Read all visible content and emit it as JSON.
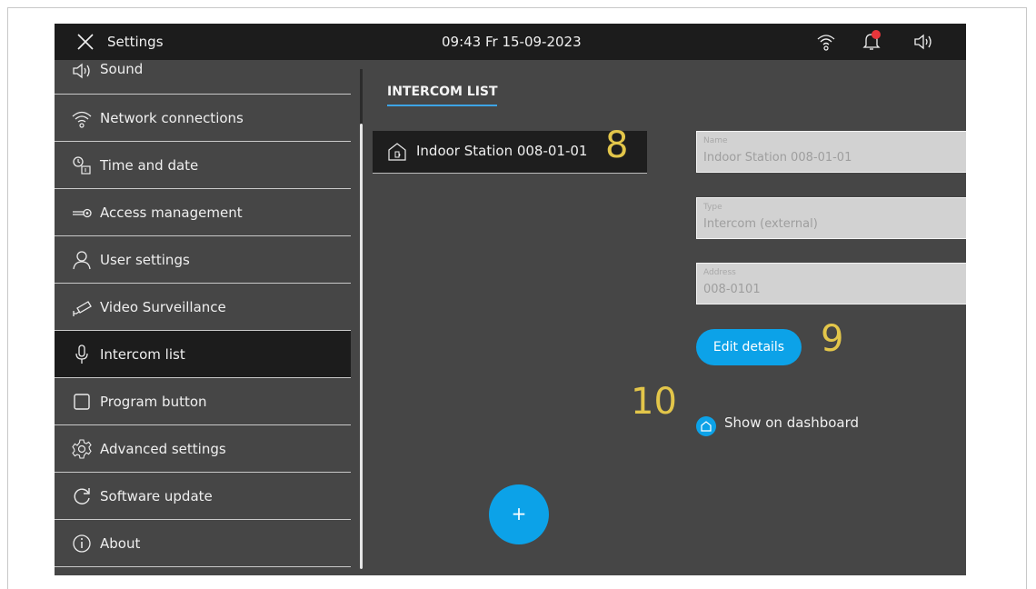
{
  "topbar": {
    "title": "Settings",
    "datetime": "09:43  Fr 15-09-2023",
    "icons": [
      "close-icon",
      "wifi-icon",
      "notification-bell-icon",
      "speaker-icon"
    ],
    "notification_dot_color": "#e8363b"
  },
  "sidebar": {
    "items": [
      {
        "label": "Sound",
        "icon": "speaker-icon"
      },
      {
        "label": "Network connections",
        "icon": "wifi-icon"
      },
      {
        "label": "Time and date",
        "icon": "clock-calendar-icon"
      },
      {
        "label": "Access  management",
        "icon": "key-icon"
      },
      {
        "label": "User settings",
        "icon": "user-icon"
      },
      {
        "label": "Video Surveillance",
        "icon": "camera-icon"
      },
      {
        "label": "Intercom list",
        "icon": "microphone-icon",
        "active": true
      },
      {
        "label": "Program button",
        "icon": "square-icon"
      },
      {
        "label": "Advanced settings",
        "icon": "gear-icon"
      },
      {
        "label": "Software update",
        "icon": "refresh-icon"
      },
      {
        "label": "About",
        "icon": "info-icon"
      }
    ]
  },
  "main": {
    "tab": "INTERCOM LIST",
    "list": [
      {
        "label": "Indoor Station 008-01-01",
        "icon": "indoor-station-icon"
      }
    ],
    "details": {
      "name_label": "Name",
      "name_value": "Indoor Station 008-01-01",
      "type_label": "Type",
      "type_value": "Intercom (external)",
      "address_label": "Address",
      "address_value": "008-0101"
    },
    "edit_button": "Edit details",
    "dashboard_label": "Show on dashboard",
    "add_button": "+"
  },
  "callouts": [
    "8",
    "9",
    "10"
  ],
  "colors": {
    "accent": "#0ca2e8",
    "background": "#464646",
    "topbar": "#1c1c1c",
    "callout": "#e3c64a"
  }
}
